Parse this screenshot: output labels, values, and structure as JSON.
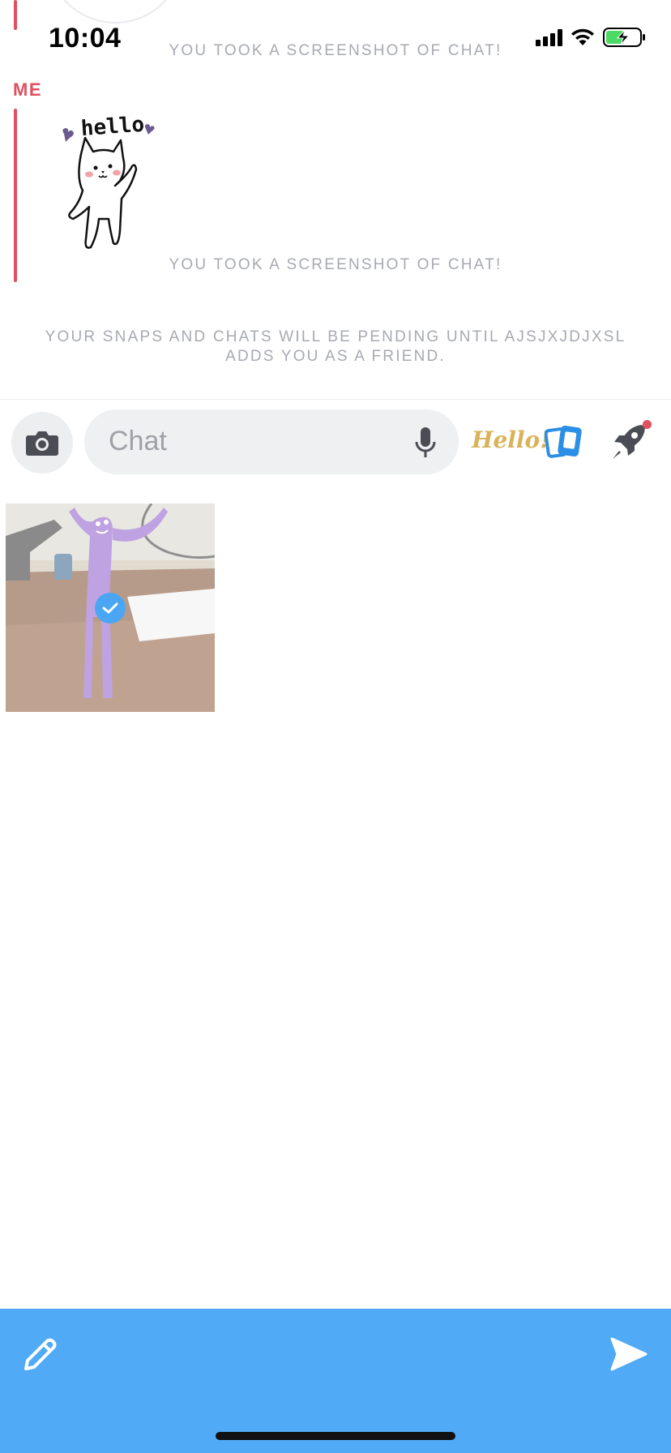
{
  "status_bar": {
    "time": "10:04"
  },
  "chat": {
    "system_message_top": "YOU TOOK A SCREENSHOT OF CHAT!",
    "sender_label": "ME",
    "sticker_text": "hello",
    "system_message_bottom": "YOU TOOK A SCREENSHOT OF CHAT!",
    "pending_notice": "YOUR SNAPS AND CHATS WILL BE PENDING UNTIL AJSJXJDJXSL ADDS YOU AS A FRIEND."
  },
  "input_bar": {
    "placeholder": "Chat",
    "hello_sticker_label": "Hello!"
  },
  "gallery": {
    "selected_count": 1
  },
  "colors": {
    "accent_red": "#e0505f",
    "action_blue": "#50aaf5",
    "system_text": "#a7aab2"
  },
  "icons": [
    "camera-icon",
    "mic-icon",
    "cards-icon",
    "rocket-icon",
    "pencil-icon",
    "send-icon",
    "checkmark-icon"
  ]
}
